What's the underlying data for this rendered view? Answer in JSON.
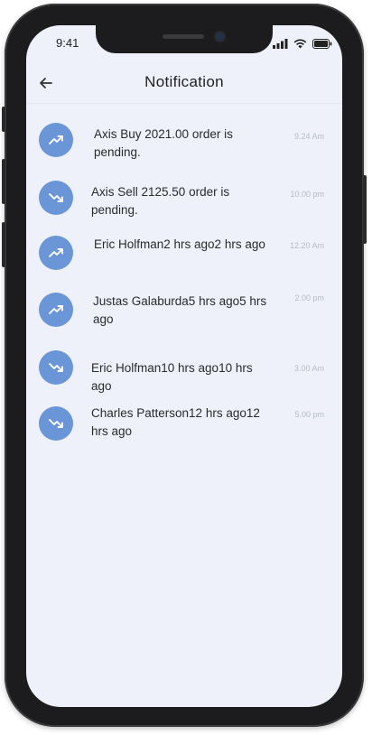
{
  "status_bar": {
    "time": "9:41"
  },
  "header": {
    "title": "Notification"
  },
  "notifications": [
    {
      "message": "Axis Buy 2021.00 order is pending.",
      "time": "9.24 Am",
      "trend": "up-trend-icon"
    },
    {
      "message": "Axis Sell 2125.50 order is pending.",
      "time": "10.00 pm",
      "trend": "down-trend-icon"
    },
    {
      "message": "Eric Holfman2 hrs ago2 hrs ago",
      "time": "12.20 Am",
      "trend": "up-trend-icon"
    },
    {
      "message": "Justas Galaburda5 hrs ago5 hrs ago",
      "time": "2.00 pm",
      "trend": "up-trend-icon"
    },
    {
      "message": "Eric Holfman10 hrs ago10 hrs ago",
      "time": "3.00 Am",
      "trend": "down-trend-icon"
    },
    {
      "message": "Charles Patterson12 hrs ago12 hrs ago",
      "time": "5.00 pm",
      "trend": "down-trend-icon"
    }
  ],
  "colors": {
    "accent": "#6a96d8",
    "background": "#eef1fa"
  }
}
